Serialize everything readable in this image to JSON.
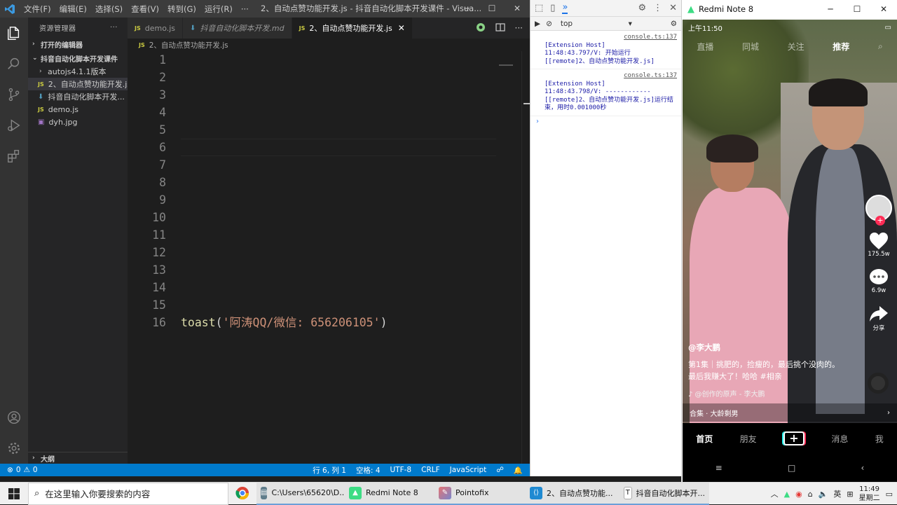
{
  "vscode": {
    "menu": [
      "文件(F)",
      "编辑(E)",
      "选择(S)",
      "查看(V)",
      "转到(G)",
      "运行(R)",
      "···"
    ],
    "window_title": "2、自动点赞功能开发.js - 抖音自动化脚本开发课件 - Visua...",
    "sidebar": {
      "title": "资源管理器",
      "open_editors": "打开的编辑器",
      "project": "抖音自动化脚本开发课件",
      "items": [
        {
          "label": "autojs4.1.1版本",
          "kind": "folder"
        },
        {
          "label": "2、自动点赞功能开发.js",
          "kind": "js"
        },
        {
          "label": "抖音自动化脚本开发...",
          "kind": "md"
        },
        {
          "label": "demo.js",
          "kind": "js"
        },
        {
          "label": "dyh.jpg",
          "kind": "img"
        }
      ],
      "outline": "大纲"
    },
    "tabs": [
      {
        "label": "demo.js",
        "kind": "js"
      },
      {
        "label": "抖音自动化脚本开发.md",
        "kind": "md"
      },
      {
        "label": "2、自动点赞功能开发.js",
        "kind": "js",
        "active": true
      }
    ],
    "breadcrumb": "2、自动点赞功能开发.js",
    "line_numbers": [
      "1",
      "2",
      "3",
      "4",
      "5",
      "6",
      "7",
      "8",
      "9",
      "10",
      "11",
      "12",
      "13",
      "14",
      "15",
      "16"
    ],
    "code": {
      "fn": "toast",
      "open": "(",
      "str": "'阿涛QQ/微信: 656206105'",
      "close": ")"
    },
    "status": {
      "errors": "0",
      "warnings": "0",
      "position": "行 6, 列 1",
      "spaces": "空格: 4",
      "encoding": "UTF-8",
      "eol": "CRLF",
      "language": "JavaScript"
    }
  },
  "devtools": {
    "context": "top",
    "messages": [
      {
        "source": "console.ts:137",
        "host": "[Extension Host]",
        "text": "11:48:43.797/V: 开始运行 [[remote]2、自动点赞功能开发.js]"
      },
      {
        "source": "console.ts:137",
        "host": "[Extension Host]",
        "text": "11:48:43.798/V: ------------ [[remote]2、自动点赞功能开发.js]运行结束，用时0.001000秒"
      }
    ]
  },
  "phone": {
    "window_title": "Redmi Note 8",
    "status_time": "上午11:50",
    "top_tabs": [
      "直播",
      "同城",
      "关注",
      "推荐"
    ],
    "likes": "175.5w",
    "comments": "6.9w",
    "share": "分享",
    "username": "@李大鹏",
    "caption_line1": "第1集｜挑肥的，捡瘦的，最后挑个没肉的。",
    "caption_line2": "最后我赚大了！哈哈 #相亲",
    "music": "♪ @创作的原声 - 李大鹏",
    "collection": "合集 · 大龄剩男",
    "nav": [
      "首页",
      "朋友",
      "+",
      "消息",
      "我"
    ]
  },
  "taskbar": {
    "search_placeholder": "在这里输入你要搜索的内容",
    "apps": [
      {
        "label": "C:\\Users\\65620\\D...",
        "icon": "terminal-icon"
      },
      {
        "label": "Redmi Note 8",
        "icon": "android-icon"
      },
      {
        "label": "Pointofix",
        "icon": "pointofix-icon"
      },
      {
        "label": "2、自动点赞功能...",
        "icon": "vscode-icon"
      },
      {
        "label": "抖音自动化脚本开...",
        "icon": "typora-icon"
      }
    ],
    "ime": "英",
    "time": "11:49",
    "day": "星期二"
  }
}
